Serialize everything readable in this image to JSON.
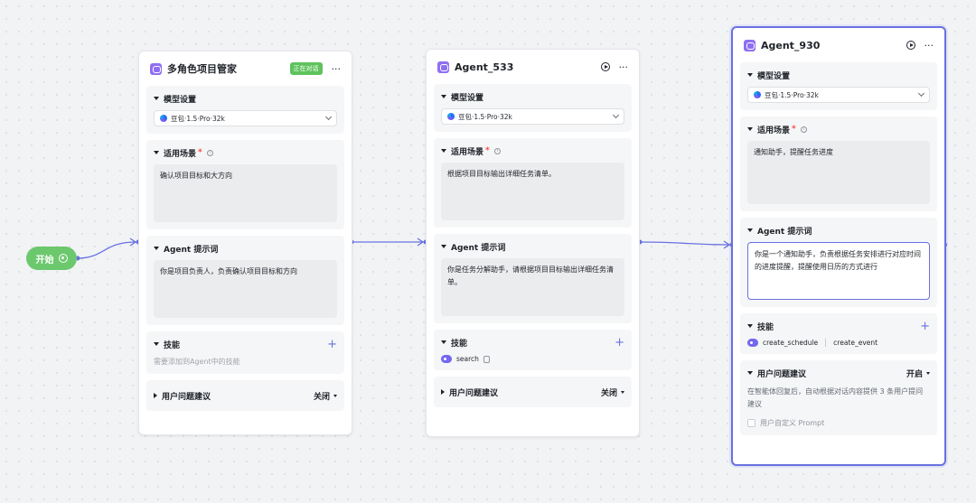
{
  "start": {
    "label": "开始"
  },
  "nodes": [
    {
      "title": "多角色项目管家",
      "badge": "正在对话",
      "model_section": "模型设置",
      "model": "豆包·1.5·Pro·32k",
      "scenario_section": "适用场景",
      "scenario_text": "确认项目目标和大方向",
      "prompt_section": "Agent 提示词",
      "prompt_text": "你是项目负责人，负责确认项目目标和方向",
      "skills_section": "技能",
      "skills_hint": "需要添加到Agent中的技能",
      "suggest_section": "用户问题建议",
      "suggest_value": "关闭"
    },
    {
      "title": "Agent_533",
      "model_section": "模型设置",
      "model": "豆包·1.5·Pro·32k",
      "scenario_section": "适用场景",
      "scenario_text": "根据项目目标输出详细任务清单。",
      "prompt_section": "Agent 提示词",
      "prompt_text": "你是任务分解助手，请根据项目目标输出详细任务清单。",
      "skills_section": "技能",
      "skill": "search",
      "suggest_section": "用户问题建议",
      "suggest_value": "关闭"
    },
    {
      "title": "Agent_930",
      "model_section": "模型设置",
      "model": "豆包·1.5·Pro·32k",
      "scenario_section": "适用场景",
      "scenario_text": "通知助手，提醒任务进度",
      "prompt_section": "Agent 提示词",
      "prompt_text": "你是一个通知助手，负责根据任务安排进行对应时间的进度提醒，提醒使用日历的方式进行",
      "skills_section": "技能",
      "skill_1": "create_schedule",
      "skill_2": "create_event",
      "suggest_section": "用户问题建议",
      "suggest_value": "开启",
      "suggest_desc": "在智能体回复后，自动根据对话内容提供 3 条用户提问建议",
      "custom_prompt_label": "用户自定义 Prompt"
    }
  ],
  "colors": {
    "accent": "#6871e0",
    "start": "#6cc86d",
    "badge": "#5ec35c"
  }
}
